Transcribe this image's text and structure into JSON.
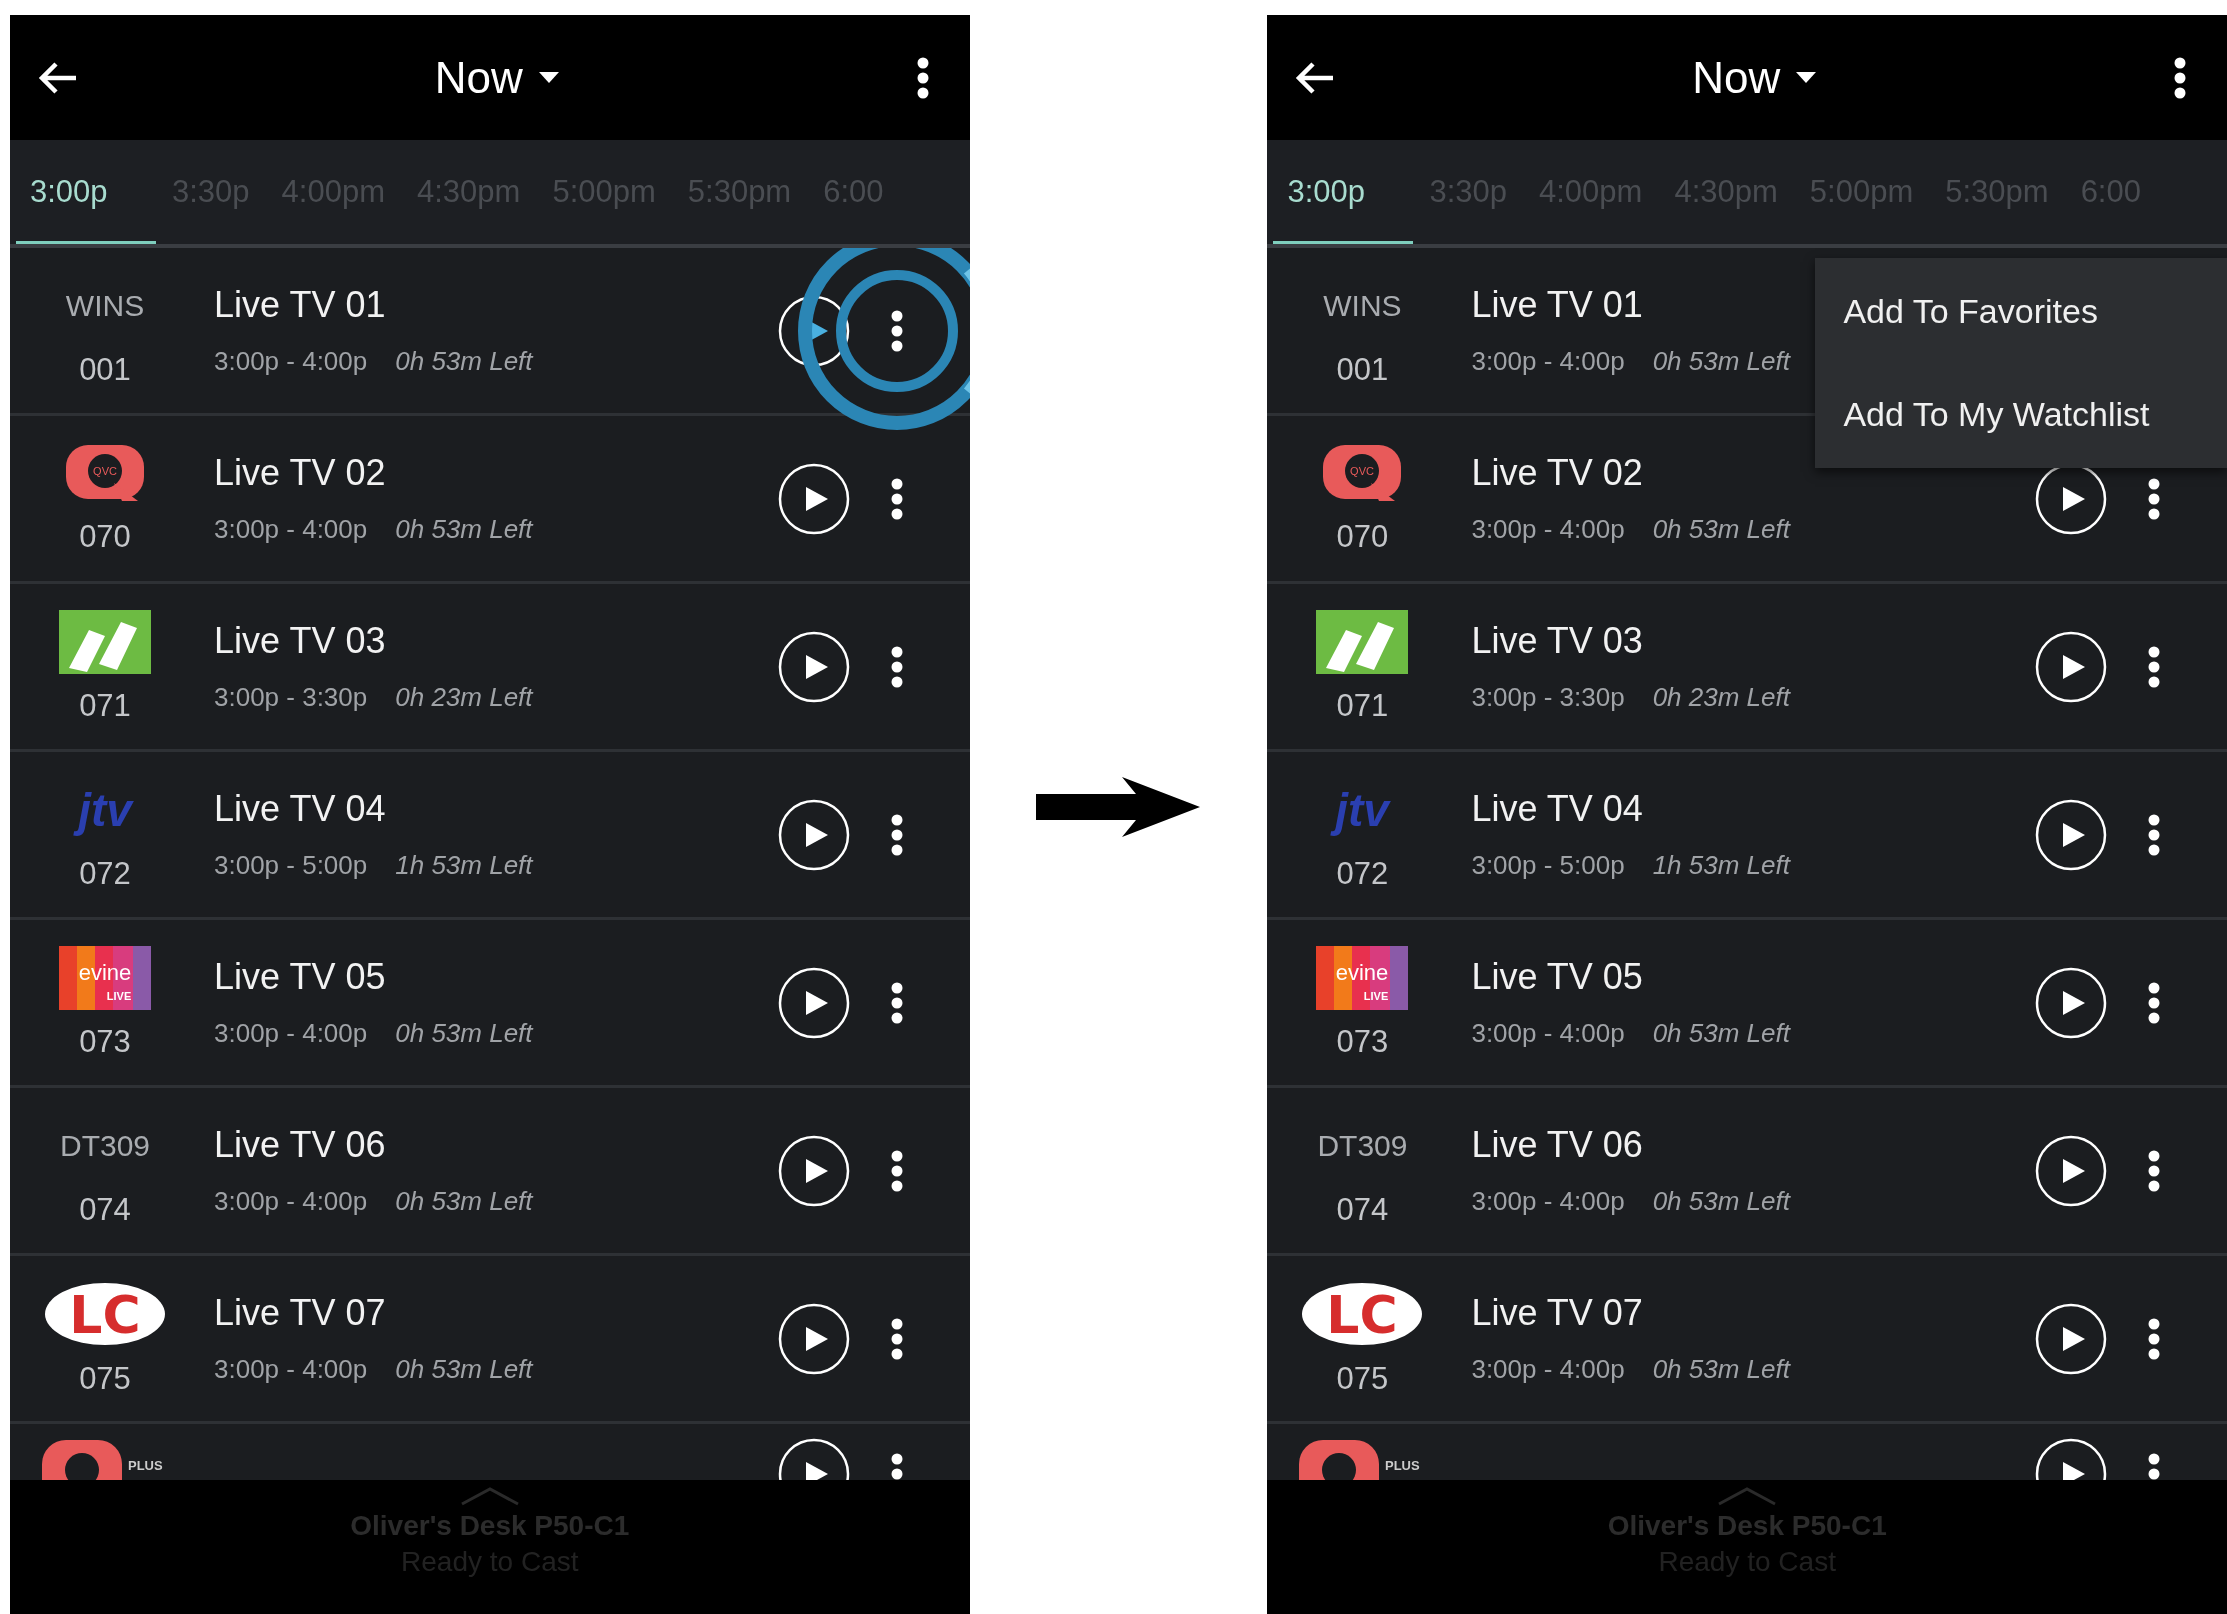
{
  "screens": [
    {
      "header": {
        "title": "Now"
      },
      "timeline": [
        {
          "label": "3:00p",
          "selected": true
        },
        {
          "label": "3:30p",
          "selected": false
        },
        {
          "label": "4:00pm",
          "selected": false
        },
        {
          "label": "4:30pm",
          "selected": false
        },
        {
          "label": "5:00pm",
          "selected": false
        },
        {
          "label": "5:30pm",
          "selected": false
        },
        {
          "label": "6:00",
          "selected": false
        }
      ],
      "channels": [
        {
          "kind": "text",
          "channel_label": "WINS",
          "number": "001",
          "title": "Live TV 01",
          "time": "3:00p - 4:00p",
          "remaining": "0h 53m Left",
          "highlighted": true
        },
        {
          "kind": "qvc",
          "logo_text": "QVC",
          "number": "070",
          "title": "Live TV 02",
          "time": "3:00p - 4:00p",
          "remaining": "0h 53m Left",
          "highlighted": false
        },
        {
          "kind": "csn",
          "number": "071",
          "title": "Live TV 03",
          "time": "3:00p - 3:30p",
          "remaining": "0h 23m Left",
          "highlighted": false
        },
        {
          "kind": "jtv",
          "logo_text": "jtv",
          "number": "072",
          "title": "Live TV 04",
          "time": "3:00p - 5:00p",
          "remaining": "1h 53m Left",
          "highlighted": false
        },
        {
          "kind": "evine",
          "logo_text": "evine",
          "logo_subtext": "LIVE",
          "number": "073",
          "title": "Live TV 05",
          "time": "3:00p - 4:00p",
          "remaining": "0h 53m Left",
          "highlighted": false
        },
        {
          "kind": "text",
          "channel_label": "DT309",
          "number": "074",
          "title": "Live TV 06",
          "time": "3:00p - 4:00p",
          "remaining": "0h 53m Left",
          "highlighted": false
        },
        {
          "kind": "lc",
          "logo_text": "LC",
          "number": "075",
          "title": "Live TV 07",
          "time": "3:00p - 4:00p",
          "remaining": "0h 53m Left",
          "highlighted": false
        },
        {
          "kind": "qvcplus",
          "logo_subtext": "PLUS",
          "highlighted": false
        }
      ],
      "cast_bar": {
        "device": "Oliver's Desk P50-C1",
        "status": "Ready to Cast"
      }
    },
    {
      "header": {
        "title": "Now"
      },
      "timeline": [
        {
          "label": "3:00p",
          "selected": true
        },
        {
          "label": "3:30p",
          "selected": false
        },
        {
          "label": "4:00pm",
          "selected": false
        },
        {
          "label": "4:30pm",
          "selected": false
        },
        {
          "label": "5:00pm",
          "selected": false
        },
        {
          "label": "5:30pm",
          "selected": false
        },
        {
          "label": "6:00",
          "selected": false
        }
      ],
      "channels": [
        {
          "kind": "text",
          "channel_label": "WINS",
          "number": "001",
          "title": "Live TV 01",
          "time": "3:00p - 4:00p",
          "remaining": "0h 53m Left",
          "highlighted": false
        },
        {
          "kind": "qvc",
          "logo_text": "QVC",
          "number": "070",
          "title": "Live TV 02",
          "time": "3:00p - 4:00p",
          "remaining": "0h 53m Left",
          "highlighted": false
        },
        {
          "kind": "csn",
          "number": "071",
          "title": "Live TV 03",
          "time": "3:00p - 3:30p",
          "remaining": "0h 23m Left",
          "highlighted": false
        },
        {
          "kind": "jtv",
          "logo_text": "jtv",
          "number": "072",
          "title": "Live TV 04",
          "time": "3:00p - 5:00p",
          "remaining": "1h 53m Left",
          "highlighted": false
        },
        {
          "kind": "evine",
          "logo_text": "evine",
          "logo_subtext": "LIVE",
          "number": "073",
          "title": "Live TV 05",
          "time": "3:00p - 4:00p",
          "remaining": "0h 53m Left",
          "highlighted": false
        },
        {
          "kind": "text",
          "channel_label": "DT309",
          "number": "074",
          "title": "Live TV 06",
          "time": "3:00p - 4:00p",
          "remaining": "0h 53m Left",
          "highlighted": false
        },
        {
          "kind": "lc",
          "logo_text": "LC",
          "number": "075",
          "title": "Live TV 07",
          "time": "3:00p - 4:00p",
          "remaining": "0h 53m Left",
          "highlighted": false
        },
        {
          "kind": "qvcplus",
          "logo_subtext": "PLUS",
          "highlighted": false
        }
      ],
      "context_menu": {
        "items": [
          "Add To Favorites",
          "Add To My Watchlist"
        ]
      },
      "cast_bar": {
        "device": "Oliver's Desk P50-C1",
        "status": "Ready to Cast"
      }
    }
  ]
}
